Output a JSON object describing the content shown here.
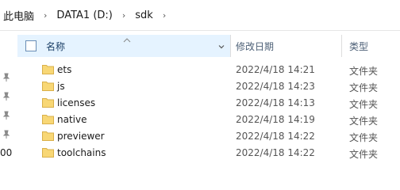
{
  "breadcrumb": {
    "items": [
      "此电脑",
      "DATA1 (D:)",
      "sdk"
    ],
    "separator": "›"
  },
  "columns": {
    "name": "名称",
    "date": "修改日期",
    "type": "类型"
  },
  "nav": {
    "partial_text": "00"
  },
  "files": [
    {
      "name": "ets",
      "date": "2022/4/18 14:21",
      "type": "文件夹"
    },
    {
      "name": "js",
      "date": "2022/4/18 14:23",
      "type": "文件夹"
    },
    {
      "name": "licenses",
      "date": "2022/4/18 14:13",
      "type": "文件夹"
    },
    {
      "name": "native",
      "date": "2022/4/18 14:19",
      "type": "文件夹"
    },
    {
      "name": "previewer",
      "date": "2022/4/18 14:22",
      "type": "文件夹"
    },
    {
      "name": "toolchains",
      "date": "2022/4/18 14:22",
      "type": "文件夹"
    }
  ],
  "colors": {
    "header_highlight": "#e5f3ff",
    "folder_yellow": "#f8d775"
  }
}
